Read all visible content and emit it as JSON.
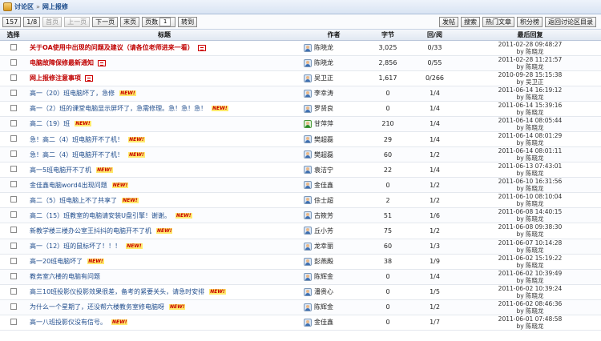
{
  "breadcrumb": {
    "root": "讨论区",
    "separator": "»",
    "current": "网上报修"
  },
  "pager": {
    "total": "157",
    "pages": "1/8",
    "first": "首页",
    "prev": "上一页",
    "next": "下一页",
    "last": "末页",
    "page_label": "页数",
    "page_value": "1",
    "goto": "转到"
  },
  "actions": {
    "post": "发帖",
    "search": "搜索",
    "hot": "热门文章",
    "points": "积分榜",
    "back": "返回讨论区目录"
  },
  "columns": {
    "select": "选择",
    "title": "标题",
    "author": "作者",
    "bytes": "字节",
    "reply": "回/阅",
    "last": "最后回复"
  },
  "rows": [
    {
      "title": "关于OA使用中出现的问题及建议（请各位老师进来一看）",
      "sticky": true,
      "attach": true,
      "new": false,
      "author": "陈晓龙",
      "avatar": "blue",
      "bytes": "3,025",
      "reply": "0/33",
      "date": "2011-02-28 09:48:27",
      "by": "by 陈晓龙"
    },
    {
      "title": "电脑故障保修最新通知",
      "sticky": true,
      "attach": true,
      "new": false,
      "author": "陈晓龙",
      "avatar": "blue",
      "bytes": "2,856",
      "reply": "0/55",
      "date": "2011-02-28 11:21:57",
      "by": "by 陈晓龙"
    },
    {
      "title": "网上报修注意事项",
      "sticky": true,
      "attach": true,
      "new": false,
      "author": "吴卫正",
      "avatar": "blue",
      "bytes": "1,617",
      "reply": "0/266",
      "date": "2010-09-28 15:15:38",
      "by": "by 吴卫正"
    },
    {
      "title": "高一（20）班电脑坏了，急修",
      "sticky": false,
      "attach": false,
      "new": true,
      "author": "李幸涛",
      "avatar": "blue",
      "bytes": "0",
      "reply": "1/4",
      "date": "2011-06-14 16:19:12",
      "by": "by 陈晓龙"
    },
    {
      "title": "高一（2）班的课堂电脑显示屏坏了，急需修理。急！急！急！",
      "sticky": false,
      "attach": false,
      "new": true,
      "author": "罗贤良",
      "avatar": "blue",
      "bytes": "0",
      "reply": "1/4",
      "date": "2011-06-14 15:39:16",
      "by": "by 陈晓龙"
    },
    {
      "title": "高二（19）班",
      "sticky": false,
      "attach": false,
      "new": true,
      "author": "甘萍萍",
      "avatar": "green",
      "bytes": "210",
      "reply": "1/4",
      "date": "2011-06-14 08:05:44",
      "by": "by 陈晓龙"
    },
    {
      "title": "急！高二（4）班电脑开不了机！",
      "sticky": false,
      "attach": false,
      "new": true,
      "author": "樊超磊",
      "avatar": "blue",
      "bytes": "29",
      "reply": "1/4",
      "date": "2011-06-14 08:01:29",
      "by": "by 陈晓龙"
    },
    {
      "title": "急！高二（4）班电脑开不了机！",
      "sticky": false,
      "attach": false,
      "new": true,
      "author": "樊超磊",
      "avatar": "blue",
      "bytes": "60",
      "reply": "1/2",
      "date": "2011-06-14 08:01:11",
      "by": "by 陈晓龙"
    },
    {
      "title": "高一5班电脑开不了机",
      "sticky": false,
      "attach": false,
      "new": true,
      "author": "袁洁宁",
      "avatar": "blue",
      "bytes": "22",
      "reply": "1/4",
      "date": "2011-06-13 07:43:01",
      "by": "by 陈晓龙"
    },
    {
      "title": "金佳鑫电脑word4出现问题",
      "sticky": false,
      "attach": false,
      "new": true,
      "author": "金佳鑫",
      "avatar": "blue",
      "bytes": "0",
      "reply": "1/2",
      "date": "2011-06-10 16:31:56",
      "by": "by 陈晓龙"
    },
    {
      "title": "高二（5）班电脑上不了共享了",
      "sticky": false,
      "attach": false,
      "new": true,
      "author": "俆士超",
      "avatar": "blue",
      "bytes": "2",
      "reply": "1/2",
      "date": "2011-06-10 08:10:04",
      "by": "by 陈晓龙"
    },
    {
      "title": "高二（15）班教室的电脑请安装U盘引擎！谢谢。",
      "sticky": false,
      "attach": false,
      "new": true,
      "author": "古筱芳",
      "avatar": "blue",
      "bytes": "51",
      "reply": "1/6",
      "date": "2011-06-08 14:40:15",
      "by": "by 陈晓龙"
    },
    {
      "title": "新教学楼三楼办公室王抖抖的电脑开不了机",
      "sticky": false,
      "attach": false,
      "new": true,
      "author": "丘小芳",
      "avatar": "blue",
      "bytes": "75",
      "reply": "1/2",
      "date": "2011-06-08 09:38:30",
      "by": "by 陈晓龙"
    },
    {
      "title": "高一（12）班的鼠标坏了！！！",
      "sticky": false,
      "attach": false,
      "new": true,
      "author": "龙幸丽",
      "avatar": "blue",
      "bytes": "60",
      "reply": "1/3",
      "date": "2011-06-07 10:14:28",
      "by": "by 陈晓龙"
    },
    {
      "title": "高一20班电脑坏了",
      "sticky": false,
      "attach": false,
      "new": true,
      "author": "彭燕殿",
      "avatar": "blue",
      "bytes": "38",
      "reply": "1/9",
      "date": "2011-06-02 15:19:22",
      "by": "by 陈晓龙"
    },
    {
      "title": "教务室六楼的电脑有问题",
      "sticky": false,
      "attach": false,
      "new": false,
      "author": "陈辉金",
      "avatar": "blue",
      "bytes": "0",
      "reply": "1/4",
      "date": "2011-06-02 10:39:49",
      "by": "by 陈晓龙"
    },
    {
      "title": "高三10班投影仪投影效果很差，备考的紧要关头，请急时安排",
      "sticky": false,
      "attach": false,
      "new": true,
      "author": "潘贵心",
      "avatar": "blue",
      "bytes": "0",
      "reply": "1/5",
      "date": "2011-06-02 10:39:24",
      "by": "by 陈晓龙"
    },
    {
      "title": "为什么一个星期了，还没帮六楼教务室修电脑呀",
      "sticky": false,
      "attach": false,
      "new": true,
      "author": "陈辉金",
      "avatar": "blue",
      "bytes": "0",
      "reply": "1/2",
      "date": "2011-06-02 08:46:36",
      "by": "by 陈晓龙"
    },
    {
      "title": "高一八班投影仪没有信号。",
      "sticky": false,
      "attach": false,
      "new": true,
      "author": "金佳鑫",
      "avatar": "blue",
      "bytes": "0",
      "reply": "1/7",
      "date": "2011-06-01 07:48:58",
      "by": "by 陈晓龙"
    }
  ]
}
